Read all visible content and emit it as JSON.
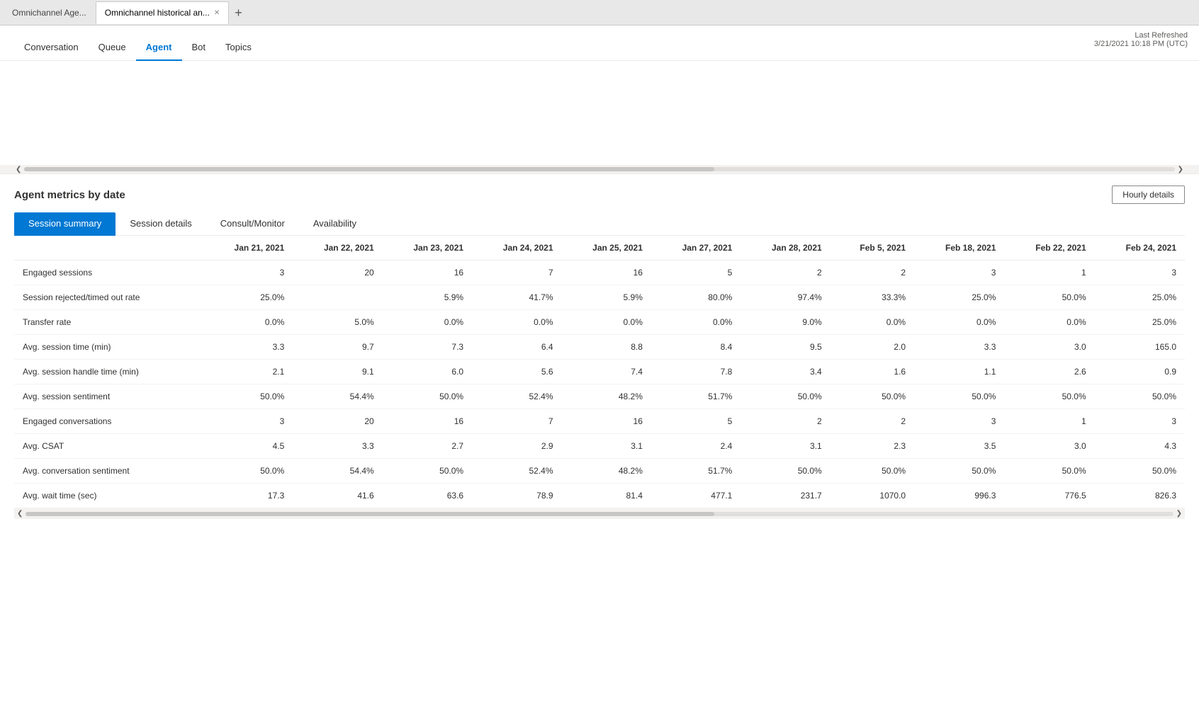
{
  "browser": {
    "tabs": [
      {
        "label": "Omnichannel Age...",
        "active": false
      },
      {
        "label": "Omnichannel historical an...",
        "active": true
      }
    ],
    "new_tab_label": "+"
  },
  "nav": {
    "items": [
      {
        "label": "Conversation",
        "active": false
      },
      {
        "label": "Queue",
        "active": false
      },
      {
        "label": "Agent",
        "active": true
      },
      {
        "label": "Bot",
        "active": false
      },
      {
        "label": "Topics",
        "active": false
      }
    ],
    "last_refreshed_label": "Last Refreshed",
    "last_refreshed_value": "3/21/2021 10:18 PM (UTC)"
  },
  "section": {
    "title": "Agent metrics by date",
    "hourly_details_label": "Hourly details"
  },
  "sub_tabs": [
    {
      "label": "Session summary",
      "active": true
    },
    {
      "label": "Session details",
      "active": false
    },
    {
      "label": "Consult/Monitor",
      "active": false
    },
    {
      "label": "Availability",
      "active": false
    }
  ],
  "table": {
    "columns": [
      "",
      "Jan 21, 2021",
      "Jan 22, 2021",
      "Jan 23, 2021",
      "Jan 24, 2021",
      "Jan 25, 2021",
      "Jan 27, 2021",
      "Jan 28, 2021",
      "Feb 5, 2021",
      "Feb 18, 2021",
      "Feb 22, 2021",
      "Feb 24, 2021"
    ],
    "rows": [
      {
        "label": "Engaged sessions",
        "values": [
          "3",
          "20",
          "16",
          "7",
          "16",
          "5",
          "2",
          "2",
          "3",
          "1",
          "3"
        ]
      },
      {
        "label": "Session rejected/timed out rate",
        "values": [
          "25.0%",
          "",
          "5.9%",
          "41.7%",
          "5.9%",
          "80.0%",
          "97.4%",
          "33.3%",
          "25.0%",
          "50.0%",
          "25.0%"
        ]
      },
      {
        "label": "Transfer rate",
        "values": [
          "0.0%",
          "5.0%",
          "0.0%",
          "0.0%",
          "0.0%",
          "0.0%",
          "9.0%",
          "0.0%",
          "0.0%",
          "0.0%",
          "25.0%"
        ]
      },
      {
        "label": "Avg. session time (min)",
        "values": [
          "3.3",
          "9.7",
          "7.3",
          "6.4",
          "8.8",
          "8.4",
          "9.5",
          "2.0",
          "3.3",
          "3.0",
          "165.0"
        ]
      },
      {
        "label": "Avg. session handle time (min)",
        "values": [
          "2.1",
          "9.1",
          "6.0",
          "5.6",
          "7.4",
          "7.8",
          "3.4",
          "1.6",
          "1.1",
          "2.6",
          "0.9"
        ]
      },
      {
        "label": "Avg. session sentiment",
        "values": [
          "50.0%",
          "54.4%",
          "50.0%",
          "52.4%",
          "48.2%",
          "51.7%",
          "50.0%",
          "50.0%",
          "50.0%",
          "50.0%",
          "50.0%"
        ]
      },
      {
        "label": "Engaged conversations",
        "values": [
          "3",
          "20",
          "16",
          "7",
          "16",
          "5",
          "2",
          "2",
          "3",
          "1",
          "3"
        ]
      },
      {
        "label": "Avg. CSAT",
        "values": [
          "4.5",
          "3.3",
          "2.7",
          "2.9",
          "3.1",
          "2.4",
          "3.1",
          "2.3",
          "3.5",
          "3.0",
          "4.3"
        ]
      },
      {
        "label": "Avg. conversation sentiment",
        "values": [
          "50.0%",
          "54.4%",
          "50.0%",
          "52.4%",
          "48.2%",
          "51.7%",
          "50.0%",
          "50.0%",
          "50.0%",
          "50.0%",
          "50.0%"
        ]
      },
      {
        "label": "Avg. wait time (sec)",
        "values": [
          "17.3",
          "41.6",
          "63.6",
          "78.9",
          "81.4",
          "477.1",
          "231.7",
          "1070.0",
          "996.3",
          "776.5",
          "826.3"
        ]
      }
    ]
  }
}
